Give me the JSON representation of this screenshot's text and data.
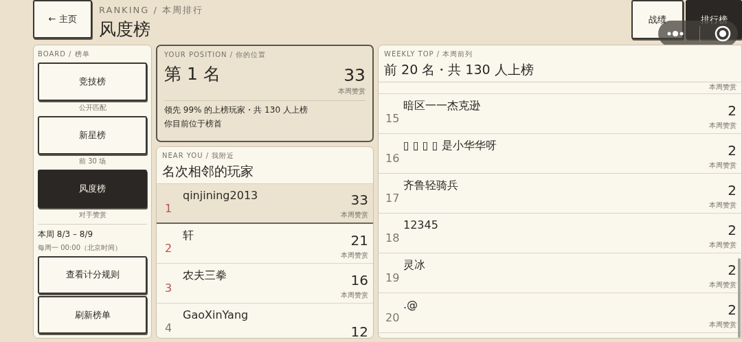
{
  "header": {
    "back_button": "← 主页",
    "eyebrow": "RANKING / 本周排行",
    "title": "风度榜"
  },
  "nav_tabs": [
    {
      "label": "战绩",
      "selected": false
    },
    {
      "label": "排行榜",
      "selected": true
    }
  ],
  "board": {
    "eyebrow": "BOARD / 榜单",
    "items": [
      {
        "label": "竞技榜",
        "caption": "公开匹配",
        "selected": false
      },
      {
        "label": "新星榜",
        "caption": "前 30 场",
        "selected": false
      },
      {
        "label": "风度榜",
        "caption": "对手赞赏",
        "selected": true
      }
    ],
    "week": "本周 8/3 – 8/9",
    "reset": "每周一 00:00（北京时间）",
    "buttons": [
      "查看计分规则",
      "刷新榜单"
    ]
  },
  "position": {
    "eyebrow": "YOUR POSITION / 你的位置",
    "rank": "第 1 名",
    "score": "33",
    "unit": "本周赞赏",
    "lead": "领先 99% 的上榜玩家・共 130 人上榜",
    "note": "你目前位于榜首"
  },
  "near_you": {
    "eyebrow": "NEAR YOU / 我附近",
    "title": "名次相邻的玩家",
    "rows": [
      {
        "rank": "1",
        "name": "qinjining2013",
        "score": "33",
        "unit": "本周赞赏",
        "selected": true,
        "color": "#b5534a"
      },
      {
        "rank": "2",
        "name": "轩",
        "score": "21",
        "unit": "本周赞赏",
        "selected": false,
        "color": "#b5534a"
      },
      {
        "rank": "3",
        "name": "农夫三拳",
        "score": "16",
        "unit": "本周赞赏",
        "selected": false,
        "color": "#b5534a"
      },
      {
        "rank": "4",
        "name": "GaoXinYang",
        "score": "12",
        "selected": false,
        "color": "#7d776e"
      }
    ]
  },
  "weekly_top": {
    "eyebrow": "WEEKLY TOP / 本周前列",
    "title": "前 20 名・共 130 人上榜",
    "partial_unit": "本周赞赏",
    "rows": [
      {
        "rank": "15",
        "name": "暗区一一杰克逊",
        "score": "2",
        "unit": "本周赞赏"
      },
      {
        "rank": "16",
        "name": "▯ ▯ ▯ ▯ 是小华华呀",
        "score": "2",
        "unit": "本周赞赏"
      },
      {
        "rank": "17",
        "name": "齐鲁轻骑兵",
        "score": "2",
        "unit": "本周赞赏"
      },
      {
        "rank": "18",
        "name": "12345",
        "score": "2",
        "unit": "本周赞赏"
      },
      {
        "rank": "19",
        "name": "灵冰",
        "score": "2",
        "unit": "本周赞赏"
      },
      {
        "rank": "20",
        "name": ".@",
        "score": "2",
        "unit": "本周赞赏"
      }
    ]
  }
}
